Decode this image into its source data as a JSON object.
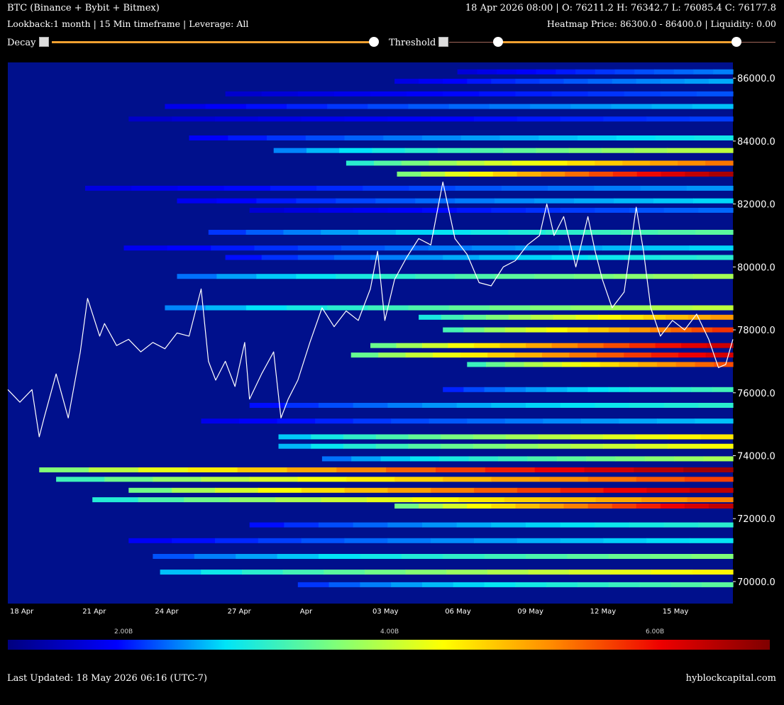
{
  "header": {
    "title": "BTC (Binance + Bybit + Bitmex)",
    "ohlc": "18 Apr 2026 08:00 | O: 76211.2 H: 76342.7 L: 76085.4 C: 76177.8",
    "settings": "Lookback:1 month | 15 Min timeframe | Leverage: All",
    "heatmap_info": "Heatmap Price: 86300.0 - 86400.0 | Liquidity: 0.00"
  },
  "controls": {
    "decay_label": "Decay",
    "threshold_label": "Threshold",
    "decay_value": 1.0,
    "threshold_low": 0.15,
    "threshold_high": 0.88,
    "accent": "#f0a030"
  },
  "chart_data": {
    "type": "heatmap",
    "title": "",
    "xlabel": "",
    "ylabel": "",
    "ylim": [
      69300,
      86500
    ],
    "yticks": [
      "70000.0",
      "72000.0",
      "74000.0",
      "76000.0",
      "78000.0",
      "80000.0",
      "82000.0",
      "84000.0",
      "86000.0"
    ],
    "yticks_values": [
      70000,
      72000,
      74000,
      76000,
      78000,
      80000,
      82000,
      84000,
      86000
    ],
    "xticks": [
      "18 Apr",
      "21 Apr",
      "24 Apr",
      "27 Apr",
      "Apr",
      "03 May",
      "06 May",
      "09 May",
      "12 May",
      "15 May"
    ],
    "xticks_days": [
      0,
      3,
      6,
      9,
      12,
      15,
      18,
      21,
      24,
      27
    ],
    "x_range_days": [
      0,
      30
    ],
    "price_series_days": [
      0,
      0.5,
      1,
      1.3,
      1.5,
      2,
      2.5,
      3,
      3.3,
      3.8,
      4,
      4.5,
      5,
      5.5,
      6,
      6.5,
      7,
      7.5,
      8,
      8.3,
      8.6,
      9,
      9.4,
      9.8,
      10,
      10.5,
      11,
      11.3,
      11.6,
      12,
      12.5,
      13,
      13.5,
      14,
      14.5,
      15,
      15.3,
      15.6,
      16,
      16.5,
      17,
      17.5,
      18,
      18.5,
      19,
      19.5,
      20,
      20.5,
      21,
      21.5,
      22,
      22.3,
      22.6,
      23,
      23.5,
      24,
      24.3,
      24.6,
      25,
      25.5,
      26,
      26.3,
      26.6,
      27,
      27.5,
      28,
      28.5,
      29,
      29.4,
      29.7,
      30
    ],
    "price_series": [
      76100,
      75700,
      76100,
      74600,
      75200,
      76600,
      75200,
      77300,
      79000,
      77800,
      78200,
      77500,
      77700,
      77300,
      77600,
      77400,
      77900,
      77800,
      79300,
      77000,
      76400,
      77000,
      76200,
      77600,
      75800,
      76600,
      77300,
      75200,
      75800,
      76400,
      77600,
      78700,
      78100,
      78600,
      78300,
      79300,
      80500,
      78300,
      79600,
      80300,
      80900,
      80700,
      82700,
      80900,
      80400,
      79500,
      79400,
      80000,
      80200,
      80700,
      81000,
      82000,
      81000,
      81600,
      80000,
      81600,
      80500,
      79600,
      78700,
      79200,
      81900,
      80500,
      78700,
      77800,
      78300,
      78000,
      78500,
      77700,
      76800,
      76900,
      77700
    ],
    "colorbar_ticks": [
      "2.00B",
      "4.00B",
      "6.00B"
    ],
    "colorbar_ticks_values": [
      2,
      4,
      6
    ],
    "colorbar_range": [
      0,
      7.2
    ],
    "liquidity_bands": [
      {
        "p": 86200,
        "d0": 18.6,
        "v": 1.6
      },
      {
        "p": 85900,
        "d0": 16.0,
        "v": 1.8
      },
      {
        "p": 85500,
        "d0": 9.0,
        "v": 1.4
      },
      {
        "p": 85100,
        "d0": 6.5,
        "v": 1.9
      },
      {
        "p": 84700,
        "d0": 5.0,
        "v": 1.3
      },
      {
        "p": 84100,
        "d0": 7.5,
        "v": 2.2
      },
      {
        "p": 83700,
        "d0": 11.0,
        "v": 3.6
      },
      {
        "p": 83300,
        "d0": 14.0,
        "v": 5.3
      },
      {
        "p": 82950,
        "d0": 16.1,
        "v": 6.8
      },
      {
        "p": 82500,
        "d0": 3.2,
        "v": 1.7
      },
      {
        "p": 82100,
        "d0": 7.0,
        "v": 2.0
      },
      {
        "p": 81800,
        "d0": 10.0,
        "v": 1.5
      },
      {
        "p": 81100,
        "d0": 8.3,
        "v": 2.8
      },
      {
        "p": 80600,
        "d0": 4.8,
        "v": 2.0
      },
      {
        "p": 80300,
        "d0": 9.0,
        "v": 2.4
      },
      {
        "p": 79700,
        "d0": 7.0,
        "v": 3.4
      },
      {
        "p": 78700,
        "d0": 6.5,
        "v": 3.6
      },
      {
        "p": 78400,
        "d0": 17.0,
        "v": 5.0
      },
      {
        "p": 78000,
        "d0": 18.0,
        "v": 5.8
      },
      {
        "p": 77500,
        "d0": 15.0,
        "v": 6.5
      },
      {
        "p": 77200,
        "d0": 14.2,
        "v": 6.4
      },
      {
        "p": 76900,
        "d0": 19.0,
        "v": 5.6
      },
      {
        "p": 76100,
        "d0": 18.0,
        "v": 2.6
      },
      {
        "p": 75600,
        "d0": 10.0,
        "v": 2.4
      },
      {
        "p": 75100,
        "d0": 8.0,
        "v": 1.9
      },
      {
        "p": 74600,
        "d0": 11.2,
        "v": 4.3
      },
      {
        "p": 74300,
        "d0": 11.2,
        "v": 4.1
      },
      {
        "p": 73900,
        "d0": 13.0,
        "v": 3.4
      },
      {
        "p": 73550,
        "d0": 1.3,
        "v": 6.9
      },
      {
        "p": 73250,
        "d0": 2.0,
        "v": 5.7
      },
      {
        "p": 72900,
        "d0": 5.0,
        "v": 6.6
      },
      {
        "p": 72600,
        "d0": 3.5,
        "v": 5.2
      },
      {
        "p": 72400,
        "d0": 16.0,
        "v": 6.6
      },
      {
        "p": 71800,
        "d0": 10.0,
        "v": 2.4
      },
      {
        "p": 71300,
        "d0": 5.0,
        "v": 2.1
      },
      {
        "p": 70800,
        "d0": 6.0,
        "v": 3.1
      },
      {
        "p": 70300,
        "d0": 6.3,
        "v": 4.2
      },
      {
        "p": 69900,
        "d0": 12.0,
        "v": 2.8
      }
    ]
  },
  "footer": {
    "last_updated": "Last Updated: 18 May 2026 06:16 (UTC-7)",
    "site": "hyblockcapital.com"
  },
  "colors": {
    "background": "#000000",
    "heatmap_base": "#00108c",
    "price_line": "#ffffff",
    "colormap": [
      "#00007f",
      "#0000ff",
      "#00e4f8",
      "#7dff7a",
      "#ffff00",
      "#ff8a00",
      "#ee0000",
      "#7f0000"
    ]
  }
}
